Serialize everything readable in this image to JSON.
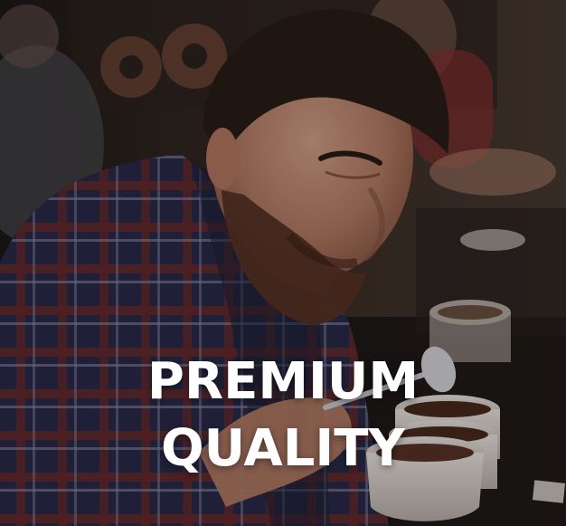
{
  "hero": {
    "title_line_1": "PREMIUM",
    "title_line_2": "QUALITY",
    "photo_subject": "coffee-cupping-photo"
  },
  "colors": {
    "title_text": "#ffffff",
    "background_dark": "#2a2220"
  }
}
